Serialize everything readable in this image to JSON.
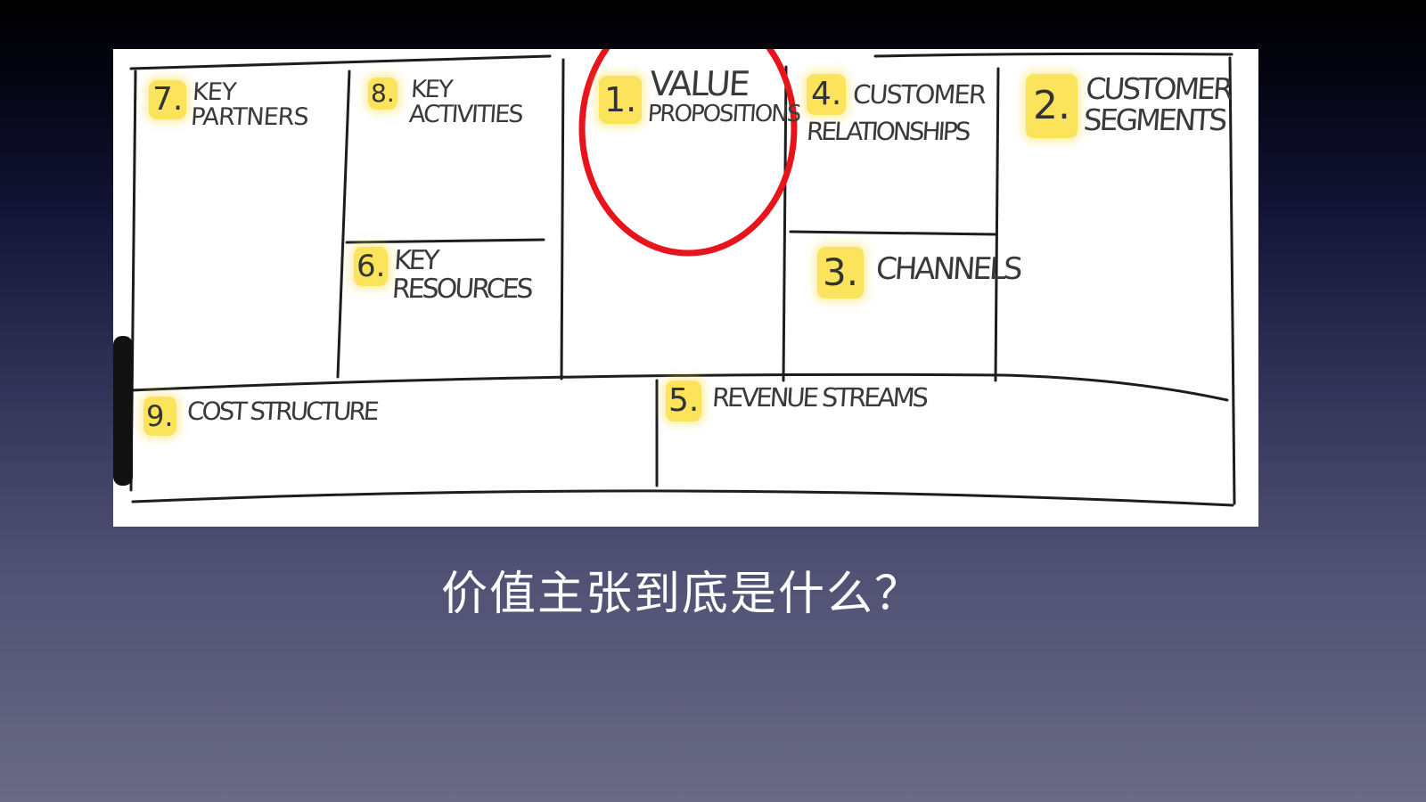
{
  "canvas": {
    "blocks": [
      {
        "id": "key-partners",
        "num": "7.",
        "lines": [
          "KEY",
          "PARTNERS"
        ]
      },
      {
        "id": "key-activities",
        "num": "8.",
        "lines": [
          "KEY",
          "ACTIVITIES"
        ]
      },
      {
        "id": "value-propositions",
        "num": "1.",
        "lines": [
          "VALUE",
          "PROPOSITIONS"
        ]
      },
      {
        "id": "customer-relationships",
        "num": "4.",
        "lines": [
          "CUSTOMER",
          "RELATIONSHIPS"
        ]
      },
      {
        "id": "customer-segments",
        "num": "2.",
        "lines": [
          "CUSTOMER",
          "SEGMENTS"
        ]
      },
      {
        "id": "key-resources",
        "num": "6.",
        "lines": [
          "KEY",
          "RESOURCES"
        ]
      },
      {
        "id": "channels",
        "num": "3.",
        "lines": [
          "CHANNELS"
        ]
      },
      {
        "id": "cost-structure",
        "num": "9.",
        "lines": [
          "COST STRUCTURE"
        ]
      },
      {
        "id": "revenue-streams",
        "num": "5.",
        "lines": [
          "REVENUE STREAMS"
        ]
      }
    ],
    "highlight_color": "#fbe45c",
    "circle_color": "#e8141b"
  },
  "caption": "价值主张到底是什么？"
}
